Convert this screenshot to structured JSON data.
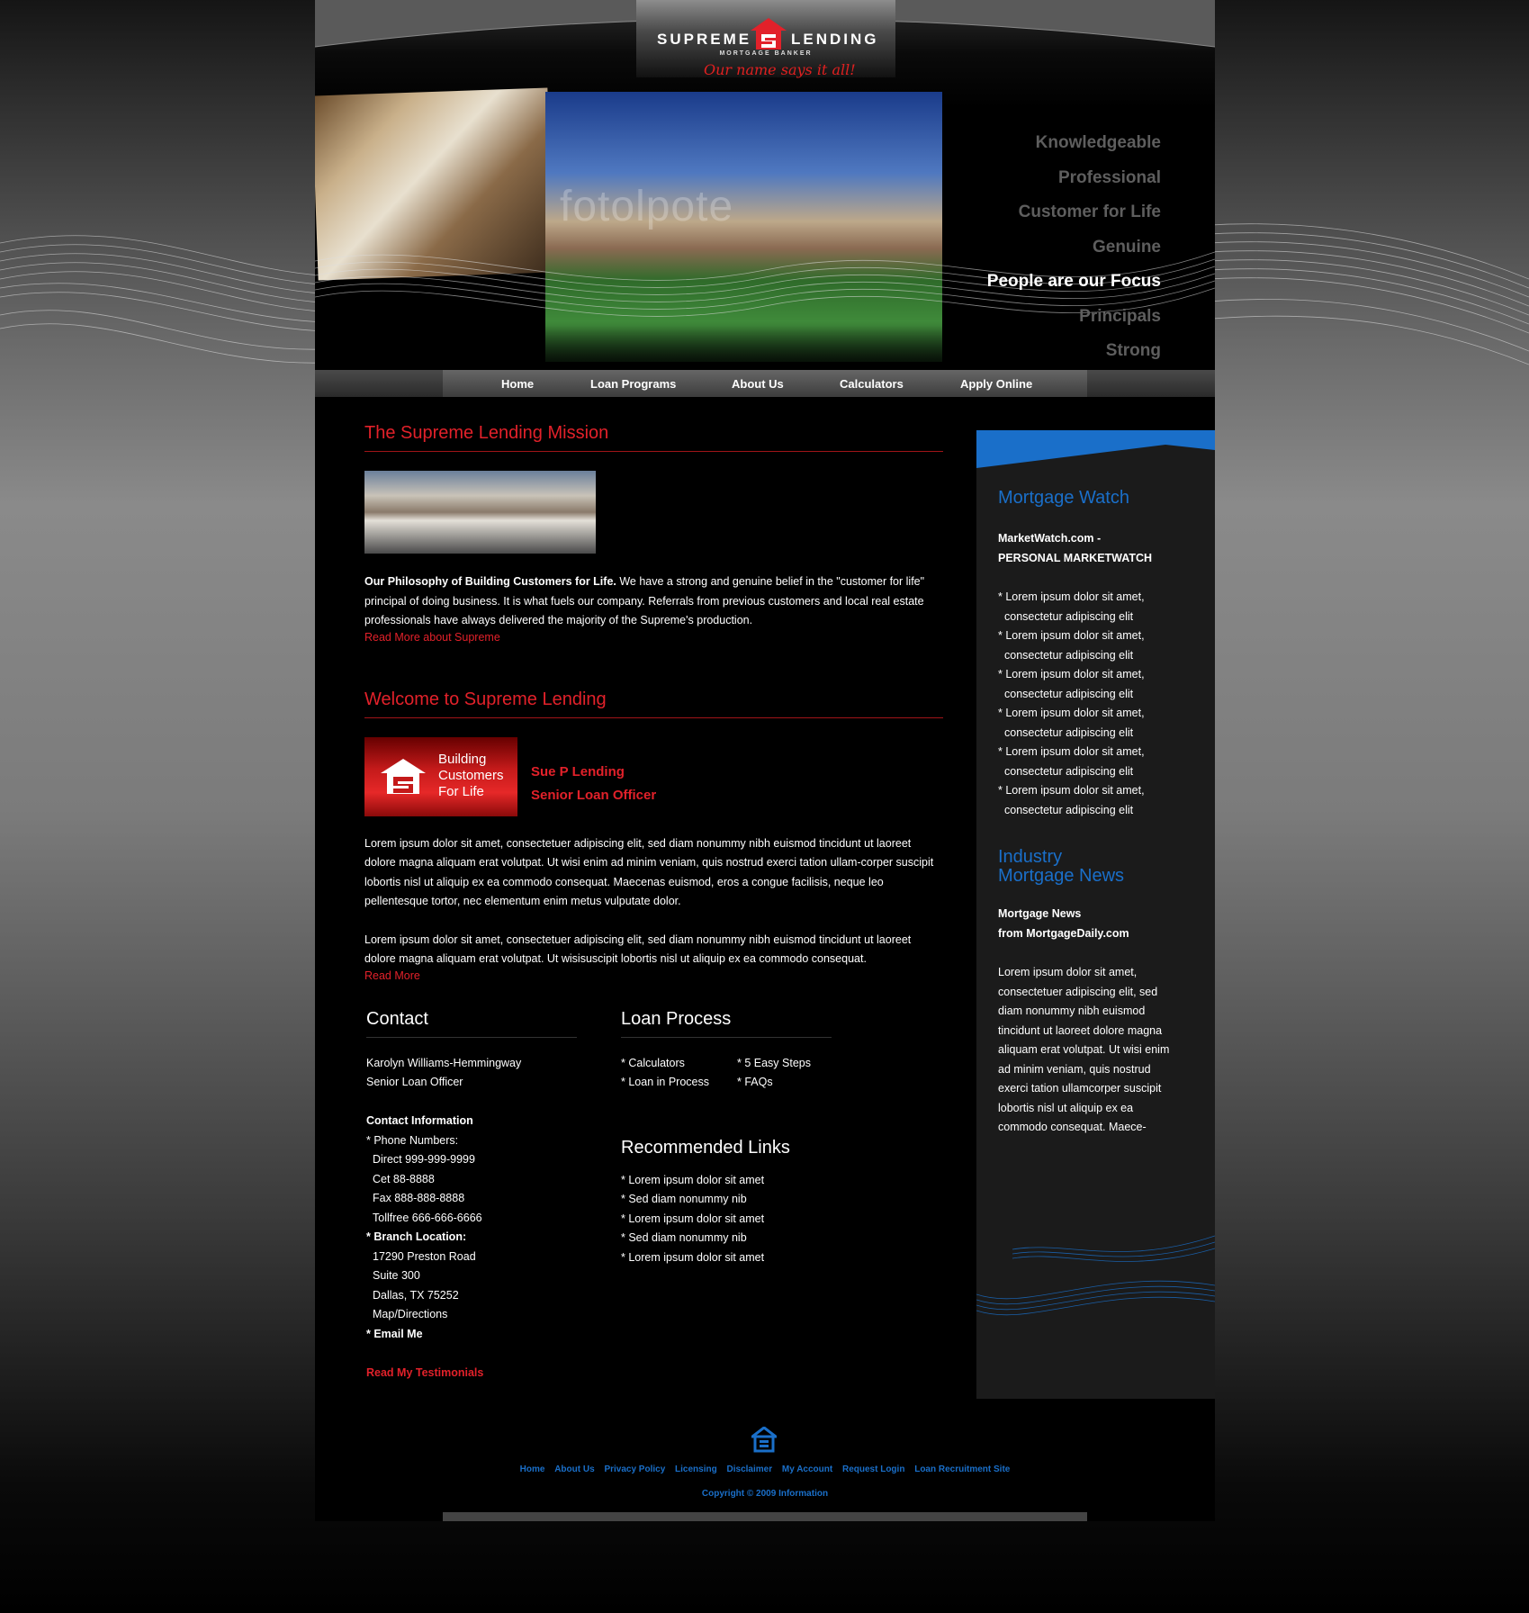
{
  "brand": {
    "name_left": "SUPREME",
    "name_right": "LENDING",
    "subtitle": "MORTGAGE BANKER",
    "tagline": "Our name says it all!",
    "accent_color": "#e2212a",
    "link_color": "#1a6fc9"
  },
  "hero": {
    "watermark": "fotolpote",
    "values": [
      "Knowledgeable",
      "Professional",
      "Customer for Life",
      "Genuine",
      "People are our Focus",
      "Principals",
      "Strong"
    ]
  },
  "nav": {
    "items": [
      "Home",
      "Loan Programs",
      "About Us",
      "Calculators",
      "Apply Online"
    ]
  },
  "mission": {
    "title": "The Supreme Lending Mission",
    "lead": "Our Philosophy of Building Customers for Life.",
    "body": " We have a strong and genuine belief in the \"customer for life\" principal of doing business. It is what fuels our company. Referrals from previous customers and local real estate professionals have always delivered the majority of the Supreme's production.",
    "link": "Read More about Supreme"
  },
  "welcome": {
    "title": "Welcome to Supreme Lending",
    "banner_lines": [
      "Building",
      "Customers",
      "For Life"
    ],
    "officer_name": "Sue P Lending",
    "officer_title": "Senior Loan Officer",
    "para1": "Lorem ipsum dolor sit amet, consectetuer adipiscing elit, sed diam nonummy nibh euismod tincidunt ut laoreet dolore magna aliquam erat volutpat. Ut wisi enim ad minim veniam, quis nostrud exerci tation ullam-corper suscipit lobortis nisl ut aliquip ex ea commodo consequat. Maecenas euismod, eros a congue facilisis, neque leo pellentesque tortor, nec elementum enim metus vulputate dolor.",
    "para2": "Lorem ipsum dolor sit amet, consectetuer adipiscing elit, sed diam nonummy nibh euismod tincidunt ut laoreet dolore magna aliquam erat volutpat. Ut wisisuscipit lobortis nisl ut aliquip ex ea commodo consequat.",
    "link": "Read More"
  },
  "contact": {
    "title": "Contact",
    "name": "Karolyn Williams-Hemmingway",
    "role": "Senior Loan Officer",
    "info_title": "Contact Information",
    "phones_label": "* Phone Numbers:",
    "phones": [
      "Direct 999-999-9999",
      "Cet 88-8888",
      "Fax 888-888-8888",
      "Tollfree 666-666-6666"
    ],
    "branch_label": "* Branch Location:",
    "address": [
      "17290 Preston Road",
      "Suite 300",
      "Dallas, TX 75252",
      "Map/Directions"
    ],
    "email": "* Email Me",
    "testimonials": "Read My Testimonials"
  },
  "loan_process": {
    "title": "Loan Process",
    "col1": [
      "* Calculators",
      "* Loan in Process"
    ],
    "col2": [
      "* 5 Easy Steps",
      "* FAQs"
    ]
  },
  "recommended": {
    "title": "Recommended Links",
    "items": [
      "* Lorem ipsum dolor sit amet",
      "* Sed diam nonummy nib",
      "* Lorem ipsum dolor sit amet",
      "* Sed diam nonummy nib",
      "* Lorem ipsum dolor sit amet"
    ]
  },
  "sidebar": {
    "watch_title": "Mortgage Watch",
    "watch_source_1": "MarketWatch.com -",
    "watch_source_2": "PERSONAL MARKETWATCH",
    "watch_items": [
      [
        "* Lorem ipsum dolor sit amet,",
        "consectetur adipiscing elit"
      ],
      [
        "* Lorem ipsum dolor sit amet,",
        "consectetur adipiscing elit"
      ],
      [
        "* Lorem ipsum dolor sit amet,",
        "consectetur adipiscing elit"
      ],
      [
        "* Lorem ipsum dolor sit amet,",
        "consectetur adipiscing elit"
      ],
      [
        "* Lorem ipsum dolor sit amet,",
        "consectetur adipiscing elit"
      ],
      [
        "* Lorem ipsum dolor sit amet,",
        "consectetur adipiscing elit"
      ]
    ],
    "news_title_1": "Industry",
    "news_title_2": "Mortgage News",
    "news_source_1": "Mortgage News",
    "news_source_2": "from MortgageDaily.com",
    "news_body": "Lorem ipsum dolor sit amet, consectetuer adipiscing elit, sed diam nonummy nibh euismod tincidunt ut laoreet dolore magna aliquam erat volutpat. Ut wisi enim ad minim veniam, quis nostrud exerci tation ullamcorper suscipit lobortis nisl ut aliquip ex ea commodo consequat. Maece-"
  },
  "footer": {
    "links": [
      "Home",
      "About Us",
      "Privacy Policy",
      "Licensing",
      "Disclaimer",
      "My Account",
      "Request Login",
      "Loan Recruitment Site"
    ],
    "copyright": "Copyright © 2009 Information",
    "icon": "equal-housing-icon"
  }
}
